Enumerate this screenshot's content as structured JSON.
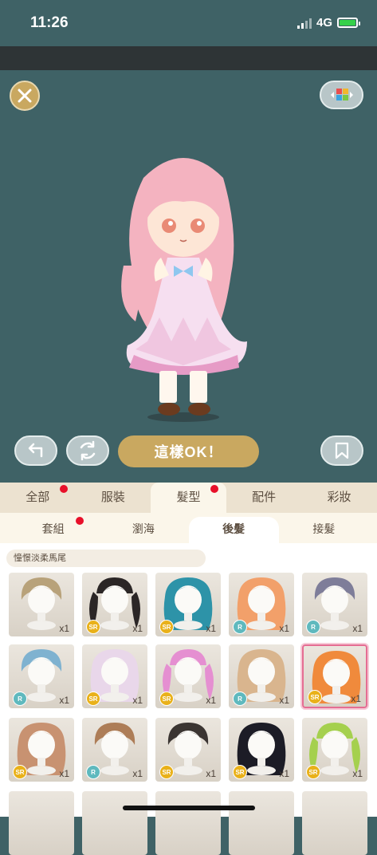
{
  "status": {
    "time": "11:26",
    "network": "4G"
  },
  "toolbar": {
    "close_icon": "close-icon",
    "palette_icon": "palette-icon"
  },
  "actions": {
    "ok_label": "這樣OK！",
    "undo_icon": "undo-icon",
    "rotate_icon": "rotate-icon",
    "bookmark_icon": "bookmark-icon"
  },
  "main_tabs": [
    {
      "label": "全部",
      "dot": true,
      "active": false
    },
    {
      "label": "服裝",
      "dot": false,
      "active": false
    },
    {
      "label": "髮型",
      "dot": true,
      "active": true
    },
    {
      "label": "配件",
      "dot": false,
      "active": false
    },
    {
      "label": "彩妝",
      "dot": false,
      "active": false
    }
  ],
  "sub_tabs": [
    {
      "label": "套組",
      "dot": true,
      "active": false
    },
    {
      "label": "瀏海",
      "dot": false,
      "active": false
    },
    {
      "label": "後髮",
      "dot": false,
      "active": true
    },
    {
      "label": "接髮",
      "dot": false,
      "active": false
    }
  ],
  "set_name": "憧憬淡柔馬尾",
  "items": [
    {
      "rarity": "",
      "count": "x1",
      "hair": "#b8a27a",
      "style": "short"
    },
    {
      "rarity": "SR",
      "count": "x1",
      "hair": "#2b2626",
      "style": "twin"
    },
    {
      "rarity": "SR",
      "count": "x1",
      "hair": "#2d93a8",
      "style": "long"
    },
    {
      "rarity": "R",
      "count": "x1",
      "hair": "#f2a06a",
      "style": "long"
    },
    {
      "rarity": "R",
      "count": "x1",
      "hair": "#7e7d99",
      "style": "short"
    },
    {
      "rarity": "R",
      "count": "x1",
      "hair": "#7fb2d0",
      "style": "short"
    },
    {
      "rarity": "SR",
      "count": "x1",
      "hair": "#e9d7ea",
      "style": "long"
    },
    {
      "rarity": "SR",
      "count": "x1",
      "hair": "#e58fd1",
      "style": "twin"
    },
    {
      "rarity": "R",
      "count": "x1",
      "hair": "#d9b58e",
      "style": "long"
    },
    {
      "rarity": "SR",
      "count": "x1",
      "hair": "#f08a3c",
      "style": "long"
    },
    {
      "rarity": "SR",
      "count": "x1",
      "hair": "#c89271",
      "style": "long"
    },
    {
      "rarity": "R",
      "count": "x1",
      "hair": "#ad7d57",
      "style": "short"
    },
    {
      "rarity": "SR",
      "count": "x1",
      "hair": "#3b3532",
      "style": "short"
    },
    {
      "rarity": "SR",
      "count": "x1",
      "hair": "#1c1c26",
      "style": "long"
    },
    {
      "rarity": "SR",
      "count": "x1",
      "hair": "#a5d04e",
      "style": "twin"
    }
  ],
  "colors": {
    "accent_gold": "#c9a860",
    "stage_bg": "#3f6266",
    "notify_dot": "#e8102a",
    "selected_border": "#e56d93"
  }
}
